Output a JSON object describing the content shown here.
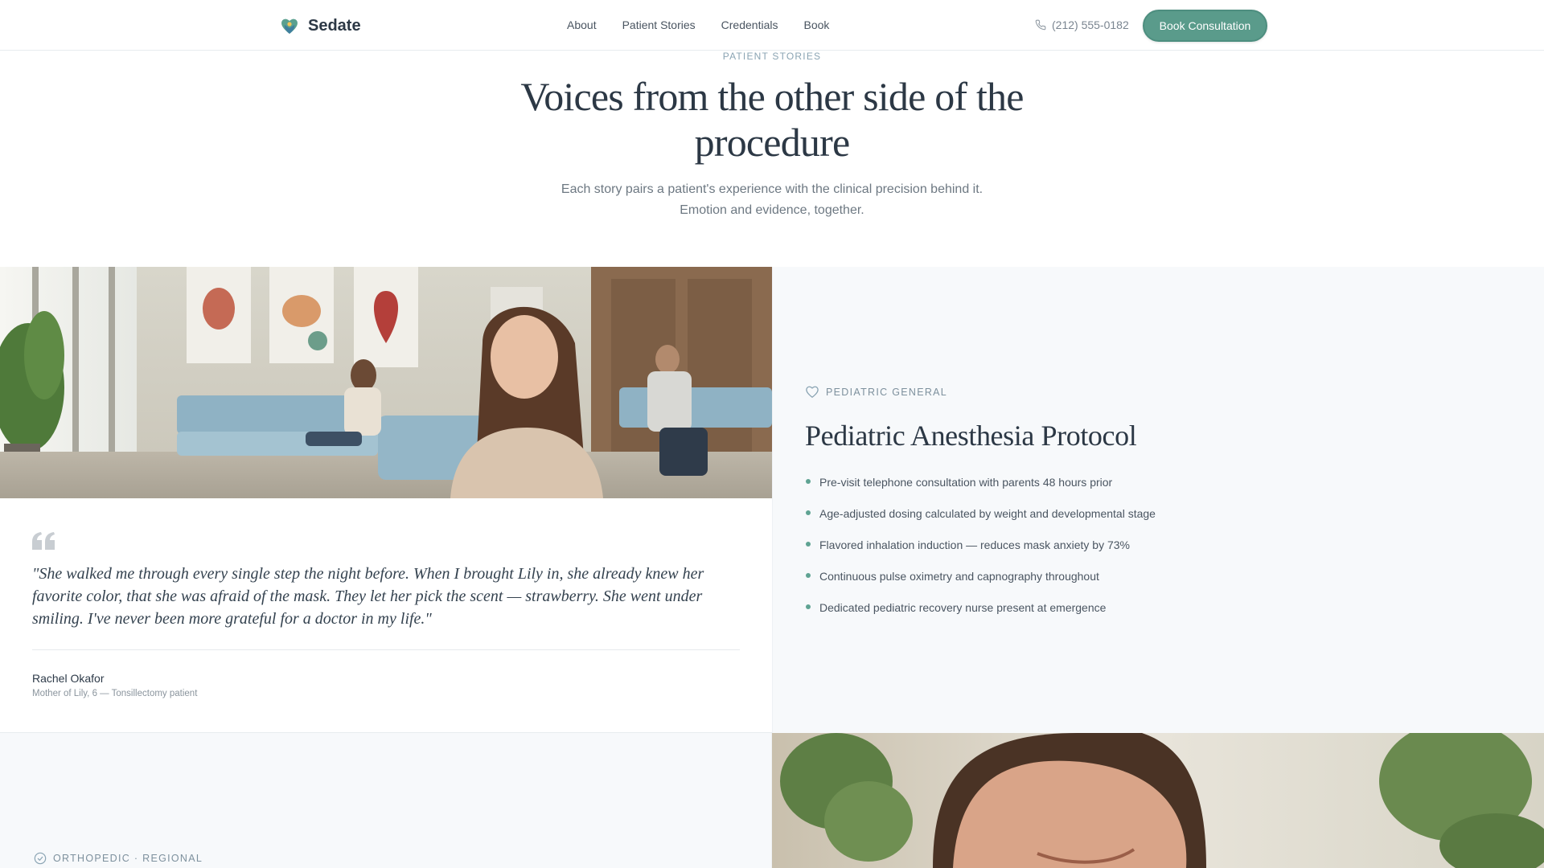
{
  "header": {
    "brand": "Sedate",
    "brand_icon": "heart-logo-icon",
    "nav": [
      "About",
      "Patient Stories",
      "Credentials",
      "Book"
    ],
    "phone": "(212) 555-0182",
    "cta": "Book Consultation"
  },
  "hero": {
    "eyebrow": "PATIENT STORIES",
    "title": "Voices from the other side of the procedure",
    "subtitle": "Each story pairs a patient's experience with the clinical precision behind it. Emotion and evidence, together."
  },
  "story1": {
    "quote": "\"She walked me through every single step the night before. When I brought Lily in, she already knew her favorite color, that she was afraid of the mask. They let her pick the scent — strawberry. She went under smiling. I've never been more grateful for a doctor in my life.\"",
    "author": "Rachel Okafor",
    "author_role": "Mother of Lily, 6 — Tonsillectomy patient",
    "tag": "PEDIATRIC GENERAL",
    "tag_icon": "heart-outline-icon",
    "title": "Pediatric Anesthesia Protocol",
    "bullets": [
      "Pre-visit telephone consultation with parents 48 hours prior",
      "Age-adjusted dosing calculated by weight and developmental stage",
      "Flavored inhalation induction — reduces mask anxiety by 73%",
      "Continuous pulse oximetry and capnography throughout",
      "Dedicated pediatric recovery nurse present at emergence"
    ]
  },
  "story2": {
    "tag": "ORTHOPEDIC · REGIONAL",
    "tag_icon": "check-circle-icon"
  },
  "colors": {
    "accent": "#5a9b8b",
    "text_dark": "#2c3845",
    "muted": "#8aa4b3",
    "panel_bg": "#f7f9fb"
  }
}
